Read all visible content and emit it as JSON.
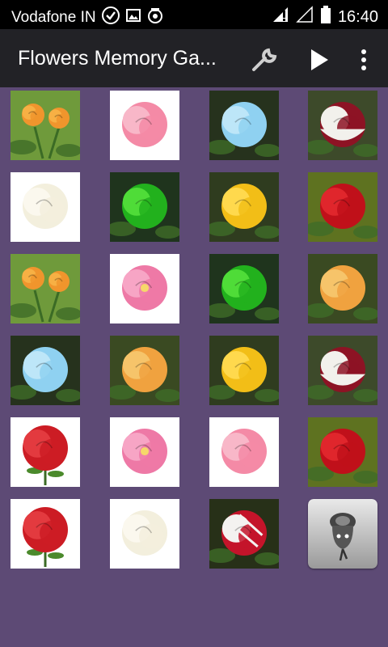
{
  "status_bar": {
    "carrier": "Vodafone IN",
    "time": "16:40",
    "icons": [
      "check-circle-icon",
      "image-icon",
      "camera-icon",
      "signal-icon",
      "signal-empty-icon",
      "battery-icon"
    ]
  },
  "app_bar": {
    "title": "Flowers Memory Ga...",
    "actions": [
      "wrench-icon",
      "play-icon",
      "overflow-menu-icon"
    ]
  },
  "grid": {
    "columns": 4,
    "rows": 6,
    "tiles": [
      "orange-roses",
      "pink-rose",
      "blue-rose",
      "red-white-rose",
      "white-rose",
      "green-rose",
      "yellow-rose",
      "red-rose",
      "orange-roses",
      "pink-camellia",
      "green-rose",
      "orange-peach-rose",
      "blue-rose",
      "orange-peach-rose",
      "yellow-rose",
      "red-white-rose",
      "red-rose-cutout",
      "pink-camellia",
      "pink-rose",
      "red-rose",
      "red-rose-cutout",
      "white-rose",
      "red-white-striped-rose",
      "card-back-rose-logo"
    ]
  },
  "colors": {
    "background": "#5d4a75",
    "app_bar": "#222226",
    "status_bar": "#000000"
  }
}
